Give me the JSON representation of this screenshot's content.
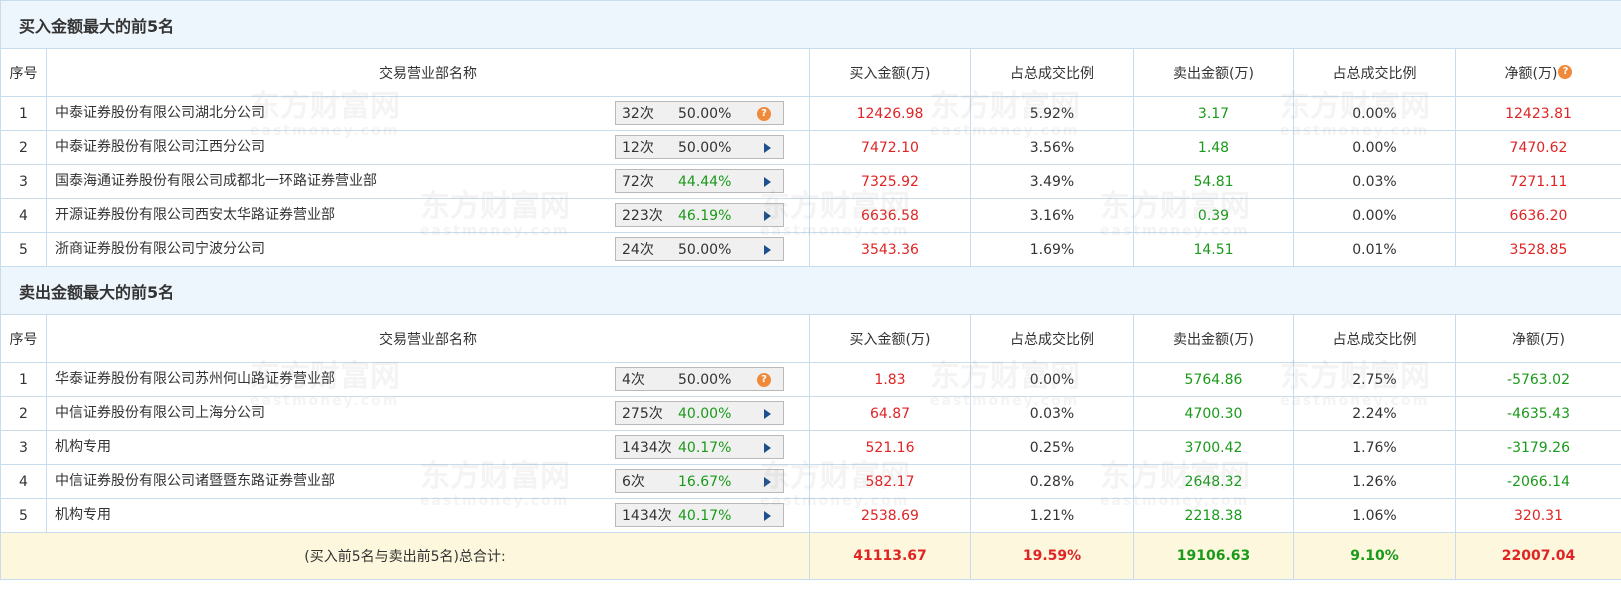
{
  "colors": {
    "section_bg": "#eef6fd",
    "border": "#c8dceb",
    "up": "#e02424",
    "down": "#1a9a1a",
    "total_bg": "#fdf8dd",
    "help_icon": "#f08a3a"
  },
  "watermark": {
    "cn": "东方财富网",
    "en": "eastmoney.com"
  },
  "headers": {
    "seq": "序号",
    "name": "交易营业部名称",
    "buy": "买入金额(万)",
    "buy_ratio": "占总成交比例",
    "sell": "卖出金额(万)",
    "sell_ratio": "占总成交比例",
    "net": "净额(万)"
  },
  "buy_section": {
    "title": "买入金额最大的前5名",
    "rows": [
      {
        "seq": "1",
        "name": "中泰证券股份有限公司湖北分公司",
        "count": "32次",
        "rate": "50.00%",
        "rate_color": "black",
        "icon": "help-icon",
        "buy": "12426.98",
        "buy_ratio": "5.92%",
        "sell": "3.17",
        "sell_ratio": "0.00%",
        "net": "12423.81",
        "net_color": "red"
      },
      {
        "seq": "2",
        "name": "中泰证券股份有限公司江西分公司",
        "count": "12次",
        "rate": "50.00%",
        "rate_color": "black",
        "icon": "arrow-right-icon",
        "buy": "7472.10",
        "buy_ratio": "3.56%",
        "sell": "1.48",
        "sell_ratio": "0.00%",
        "net": "7470.62",
        "net_color": "red"
      },
      {
        "seq": "3",
        "name": "国泰海通证券股份有限公司成都北一环路证券营业部",
        "count": "72次",
        "rate": "44.44%",
        "rate_color": "green",
        "icon": "arrow-right-icon",
        "buy": "7325.92",
        "buy_ratio": "3.49%",
        "sell": "54.81",
        "sell_ratio": "0.03%",
        "net": "7271.11",
        "net_color": "red"
      },
      {
        "seq": "4",
        "name": "开源证券股份有限公司西安太华路证券营业部",
        "count": "223次",
        "rate": "46.19%",
        "rate_color": "green",
        "icon": "arrow-right-icon",
        "buy": "6636.58",
        "buy_ratio": "3.16%",
        "sell": "0.39",
        "sell_ratio": "0.00%",
        "net": "6636.20",
        "net_color": "red"
      },
      {
        "seq": "5",
        "name": "浙商证券股份有限公司宁波分公司",
        "count": "24次",
        "rate": "50.00%",
        "rate_color": "black",
        "icon": "arrow-right-icon",
        "buy": "3543.36",
        "buy_ratio": "1.69%",
        "sell": "14.51",
        "sell_ratio": "0.01%",
        "net": "3528.85",
        "net_color": "red"
      }
    ]
  },
  "sell_section": {
    "title": "卖出金额最大的前5名",
    "rows": [
      {
        "seq": "1",
        "name": "华泰证券股份有限公司苏州何山路证券营业部",
        "count": "4次",
        "rate": "50.00%",
        "rate_color": "black",
        "icon": "help-icon",
        "buy": "1.83",
        "buy_ratio": "0.00%",
        "sell": "5764.86",
        "sell_ratio": "2.75%",
        "net": "-5763.02",
        "net_color": "green"
      },
      {
        "seq": "2",
        "name": "中信证券股份有限公司上海分公司",
        "count": "275次",
        "rate": "40.00%",
        "rate_color": "green",
        "icon": "arrow-right-icon",
        "buy": "64.87",
        "buy_ratio": "0.03%",
        "sell": "4700.30",
        "sell_ratio": "2.24%",
        "net": "-4635.43",
        "net_color": "green"
      },
      {
        "seq": "3",
        "name": "机构专用",
        "count": "1434次",
        "rate": "40.17%",
        "rate_color": "green",
        "icon": "arrow-right-icon",
        "buy": "521.16",
        "buy_ratio": "0.25%",
        "sell": "3700.42",
        "sell_ratio": "1.76%",
        "net": "-3179.26",
        "net_color": "green"
      },
      {
        "seq": "4",
        "name": "中信证券股份有限公司诸暨暨东路证券营业部",
        "count": "6次",
        "rate": "16.67%",
        "rate_color": "green",
        "icon": "arrow-right-icon",
        "buy": "582.17",
        "buy_ratio": "0.28%",
        "sell": "2648.32",
        "sell_ratio": "1.26%",
        "net": "-2066.14",
        "net_color": "green"
      },
      {
        "seq": "5",
        "name": "机构专用",
        "count": "1434次",
        "rate": "40.17%",
        "rate_color": "green",
        "icon": "arrow-right-icon",
        "buy": "2538.69",
        "buy_ratio": "1.21%",
        "sell": "2218.38",
        "sell_ratio": "1.06%",
        "net": "320.31",
        "net_color": "red"
      }
    ]
  },
  "total": {
    "label": "(买入前5名与卖出前5名)总合计:",
    "buy": "41113.67",
    "buy_ratio": "19.59%",
    "sell": "19106.63",
    "sell_ratio": "9.10%",
    "net": "22007.04"
  }
}
